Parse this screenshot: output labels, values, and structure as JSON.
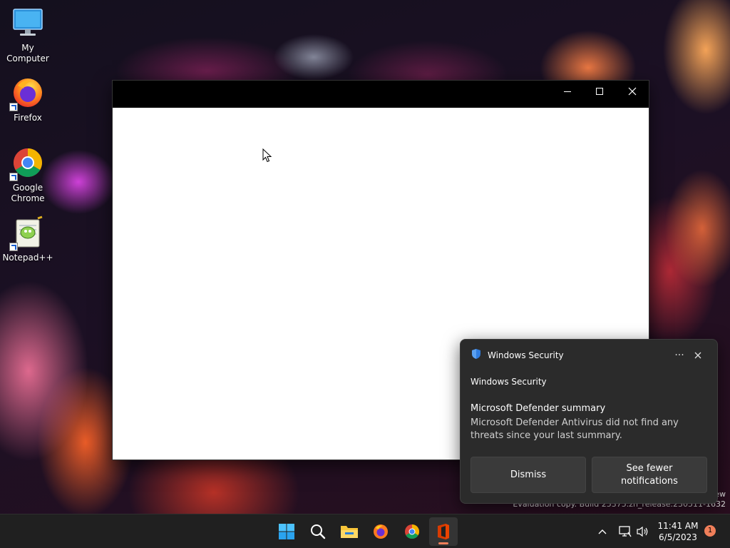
{
  "desktop": {
    "icons": [
      {
        "label": "My Computer"
      },
      {
        "label": "Firefox"
      },
      {
        "label": "Google Chrome"
      },
      {
        "label": "Notepad++"
      }
    ],
    "watermark_edge": "ew",
    "watermark": "Evaluation copy. Build 25375.zn_release.230511-1632"
  },
  "window": {
    "controls": [
      "minimize",
      "maximize",
      "close"
    ]
  },
  "toast": {
    "app_name": "Windows Security",
    "attribution": "Windows Security",
    "title": "Microsoft Defender summary",
    "body": "Microsoft Defender Antivirus did not find any threats since your last summary.",
    "dismiss_label": "Dismiss",
    "fewer_label": "See fewer notifications",
    "more_glyph": "···"
  },
  "taskbar": {
    "apps": [
      "start",
      "search",
      "file-explorer",
      "firefox",
      "chrome",
      "office"
    ],
    "active_app": "office",
    "clock_time": "11:41 AM",
    "clock_date": "6/5/2023",
    "notification_count": "1"
  },
  "colors": {
    "accent": "#f07f5a",
    "taskbar_bg": "#202020",
    "toast_bg": "#2b2b2b"
  }
}
